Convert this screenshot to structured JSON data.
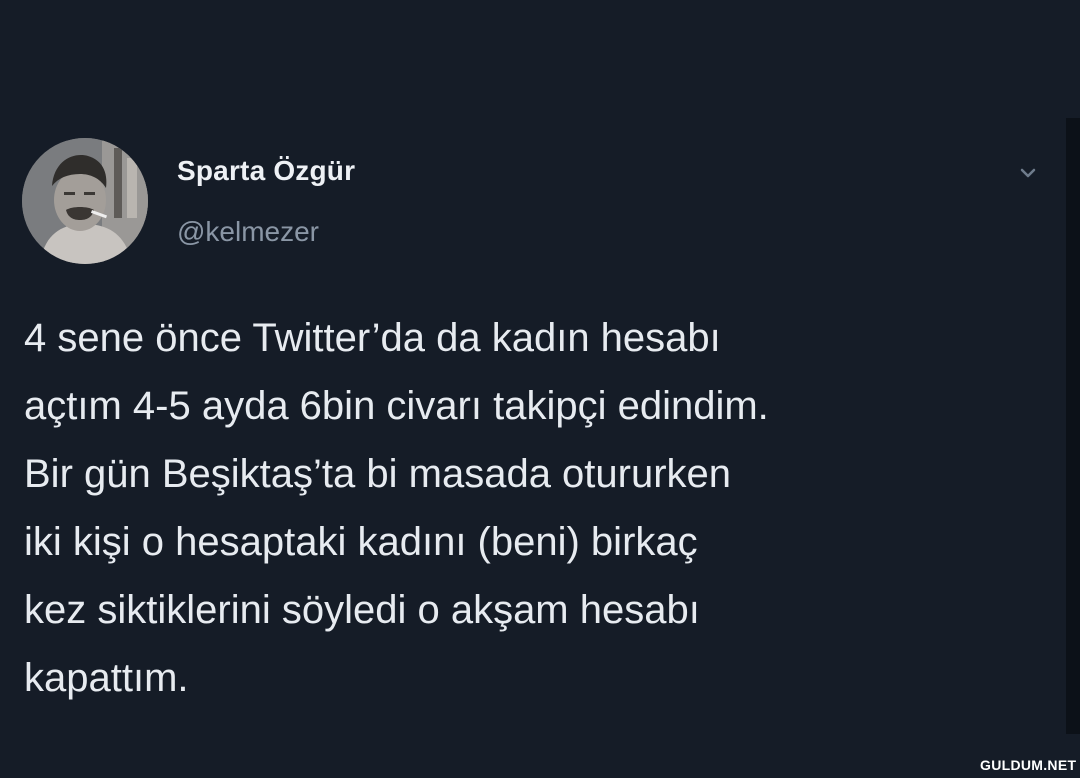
{
  "tweet": {
    "author_name": "Sparta Özgür",
    "author_handle": "@kelmezer",
    "text": "4 sene önce Twitter’da da  kadın hesabı\naçtım 4-5 ayda 6bin civarı takipçi edindim.\nBir gün Beşiktaş’ta bi masada otururken\niki kişi o hesaptaki kadını (beni) birkaç\nkez siktiklerini söyledi o akşam hesabı\nkapattım.",
    "menu_icon": "chevron-down-icon",
    "avatar_icon": "profile-photo"
  },
  "watermark": "GULDUM.NET",
  "colors": {
    "background": "#151c27",
    "text": "#e7ebf0",
    "handle": "#8a96a5"
  }
}
